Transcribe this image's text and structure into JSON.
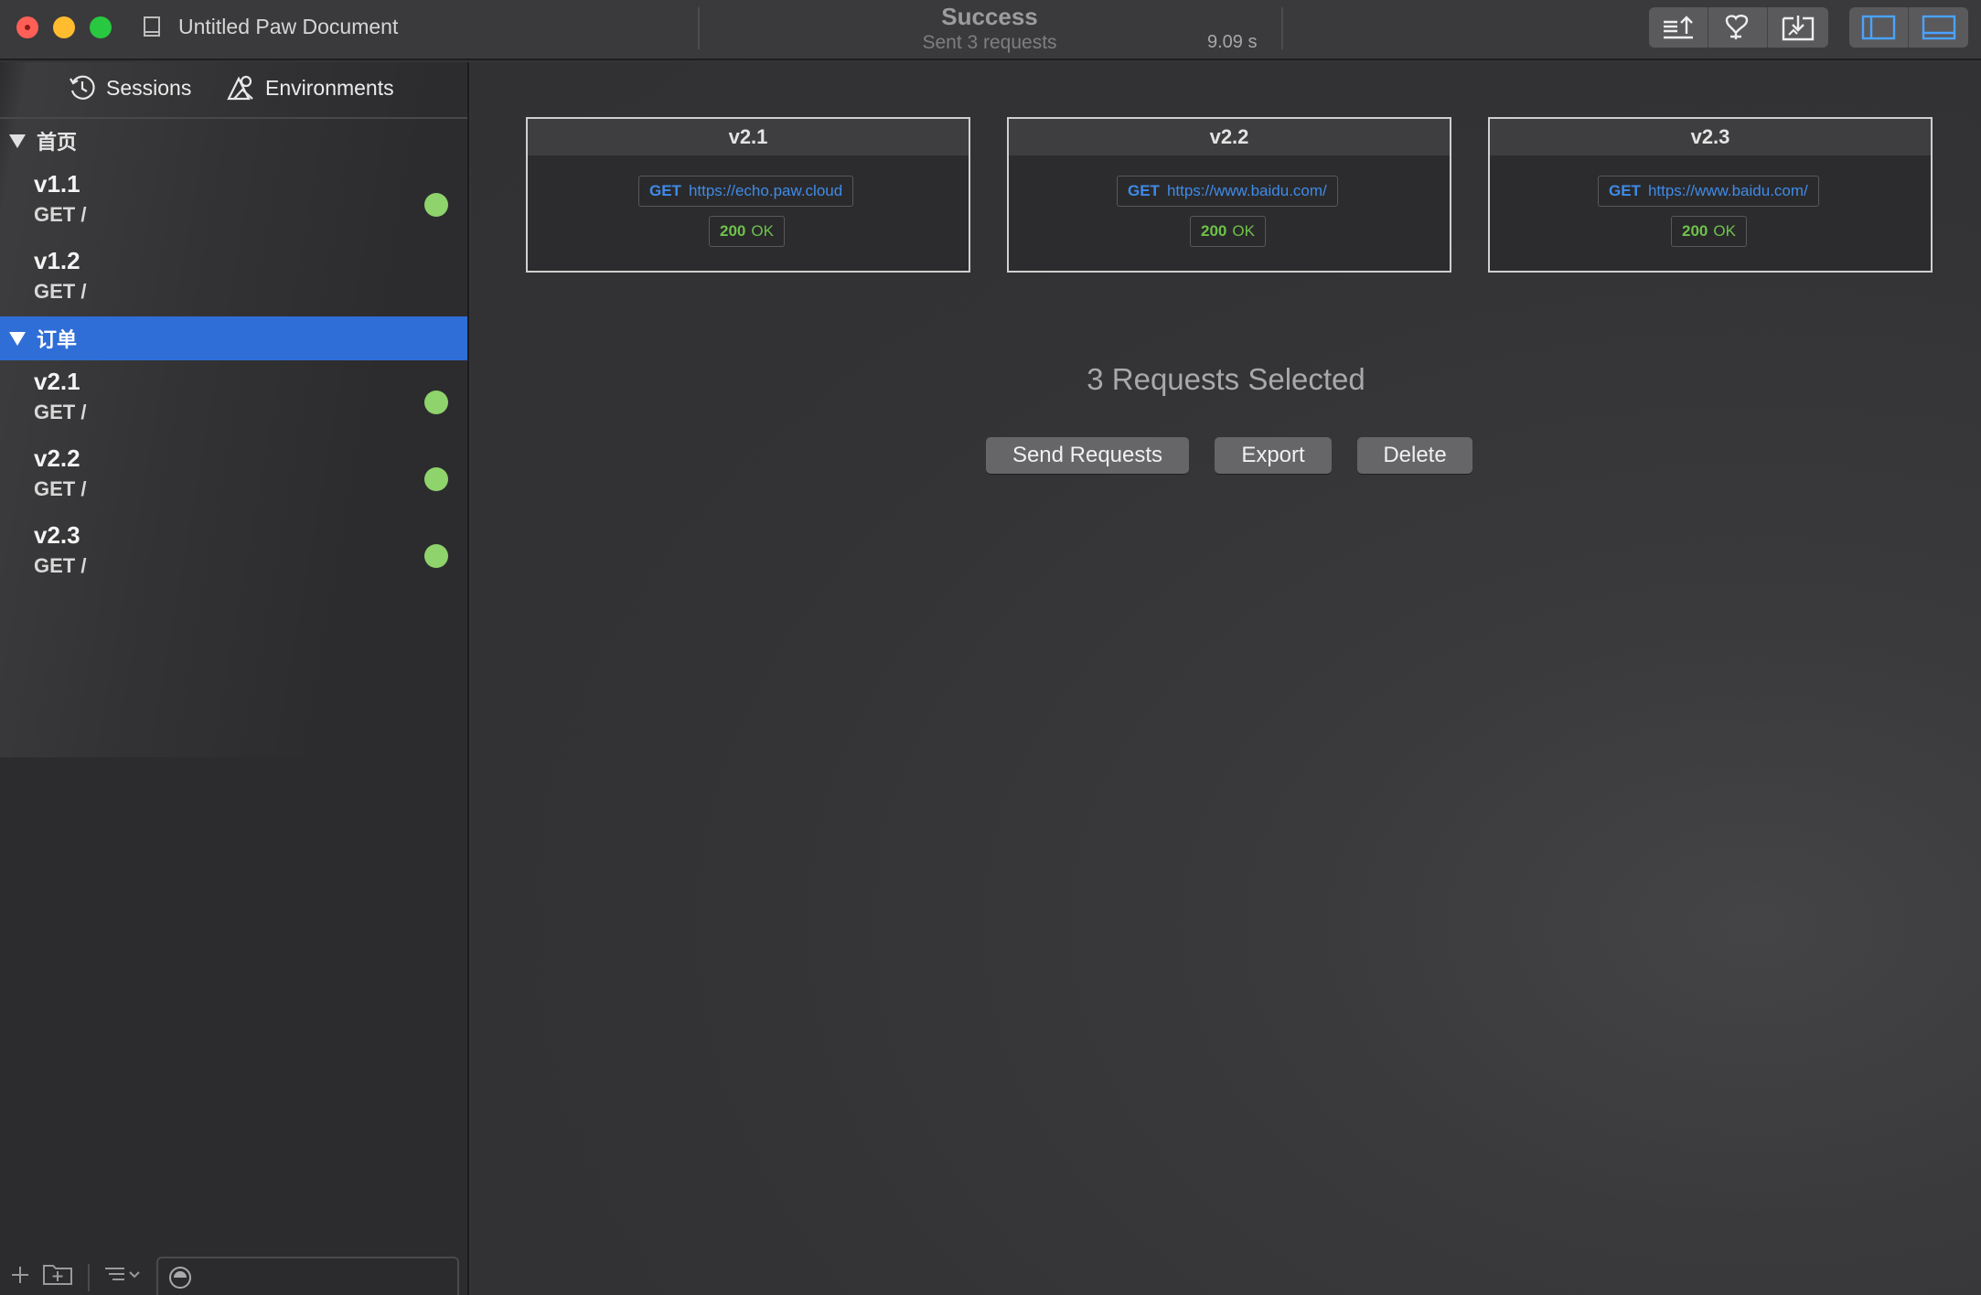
{
  "window": {
    "document_title": "Untitled Paw Document",
    "status_title": "Success",
    "status_subtitle": "Sent 3 requests",
    "status_time": "9.09 s",
    "toolbar_icons": [
      "export-icon",
      "cookie-jar-icon",
      "import-icon"
    ],
    "layout_icons": [
      "left-sidebar-icon",
      "bottom-panel-icon"
    ],
    "accent_color": "#2f6ed6"
  },
  "sidebar": {
    "tabs": [
      {
        "label": "Sessions",
        "icon": "clock-icon"
      },
      {
        "label": "Environments",
        "icon": "environments-icon"
      }
    ],
    "groups": [
      {
        "label": "首页",
        "selected": false,
        "requests": [
          {
            "name": "v1.1",
            "method_path": "GET /",
            "status": "success"
          },
          {
            "name": "v1.2",
            "method_path": "GET /",
            "status": "none"
          }
        ]
      },
      {
        "label": "订单",
        "selected": true,
        "requests": [
          {
            "name": "v2.1",
            "method_path": "GET /",
            "status": "success"
          },
          {
            "name": "v2.2",
            "method_path": "GET /",
            "status": "success"
          },
          {
            "name": "v2.3",
            "method_path": "GET /",
            "status": "success"
          }
        ]
      }
    ],
    "status_colors": {
      "success": "#8ed36b"
    },
    "filter_placeholder": ""
  },
  "main": {
    "cards": [
      {
        "title": "v2.1",
        "method": "GET",
        "url": "https://echo.paw.cloud",
        "code": "200",
        "code_text": "OK"
      },
      {
        "title": "v2.2",
        "method": "GET",
        "url": "https://www.baidu.com/",
        "code": "200",
        "code_text": "OK"
      },
      {
        "title": "v2.3",
        "method": "GET",
        "url": "https://www.baidu.com/",
        "code": "200",
        "code_text": "OK"
      }
    ],
    "selection_title": "3 Requests Selected",
    "actions": {
      "send": "Send Requests",
      "export": "Export",
      "delete": "Delete"
    }
  }
}
